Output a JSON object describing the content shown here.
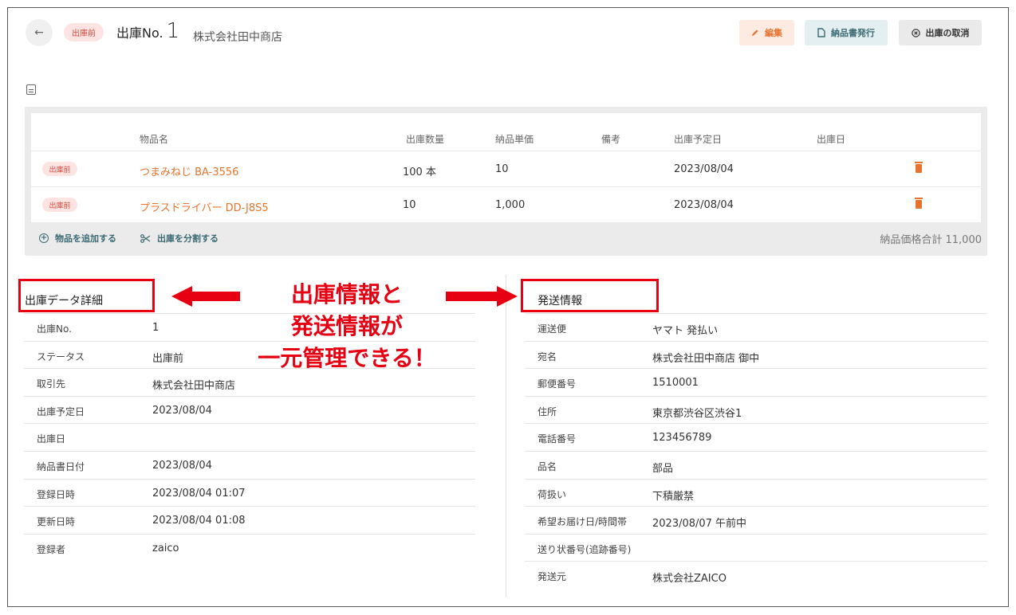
{
  "header": {
    "back_icon": "arrow-left-icon",
    "status": "出庫前",
    "title_prefix": "出庫No.",
    "title_number": "1",
    "vendor": "株式会社田中商店",
    "buttons": {
      "edit": "編集",
      "invoice": "納品書発行",
      "cancel": "出庫の取消"
    }
  },
  "items": {
    "columns": [
      "物品名",
      "出庫数量",
      "納品単価",
      "備考",
      "出庫予定日",
      "出庫日"
    ],
    "rows": [
      {
        "status": "出庫前",
        "name": "つまみねじ BA-3556",
        "qty": "100 本",
        "price": "10",
        "note": "",
        "planned": "2023/08/04",
        "date": ""
      },
      {
        "status": "出庫前",
        "name": "プラスドライバー DD-J8S5",
        "qty": "10",
        "price": "1,000",
        "note": "",
        "planned": "2023/08/04",
        "date": ""
      }
    ],
    "add_label": "物品を追加する",
    "split_label": "出庫を分割する",
    "total_label": "納品価格合計",
    "total_value": "11,000"
  },
  "detail": {
    "title": "出庫データ詳細",
    "rows": [
      {
        "key": "出庫No.",
        "value": "1"
      },
      {
        "key": "ステータス",
        "value": "出庫前"
      },
      {
        "key": "取引先",
        "value": "株式会社田中商店"
      },
      {
        "key": "出庫予定日",
        "value": "2023/08/04"
      },
      {
        "key": "出庫日",
        "value": ""
      },
      {
        "key": "納品書日付",
        "value": "2023/08/04"
      },
      {
        "key": "登録日時",
        "value": "2023/08/04 01:07"
      },
      {
        "key": "更新日時",
        "value": "2023/08/04 01:08"
      },
      {
        "key": "登録者",
        "value": "zaico"
      }
    ]
  },
  "shipping": {
    "title": "発送情報",
    "rows": [
      {
        "key": "運送便",
        "value": "ヤマト 発払い"
      },
      {
        "key": "宛名",
        "value": "株式会社田中商店 御中"
      },
      {
        "key": "郵便番号",
        "value": "1510001"
      },
      {
        "key": "住所",
        "value": "東京都渋谷区渋谷1"
      },
      {
        "key": "電話番号",
        "value": "123456789"
      },
      {
        "key": "品名",
        "value": "部品"
      },
      {
        "key": "荷扱い",
        "value": "下積厳禁"
      },
      {
        "key": "希望お届け日/時間帯",
        "value": "2023/08/07 午前中"
      },
      {
        "key": "送り状番号(追跡番号)",
        "value": ""
      },
      {
        "key": "発送元",
        "value": "株式会社ZAICO"
      }
    ]
  },
  "annotation": {
    "lines": [
      "出庫情報と",
      "発送情報が",
      "一元管理できる！"
    ],
    "color": "#e60012"
  },
  "colors": {
    "accent": "#e5742e",
    "teal": "#3c6a73",
    "status_bg": "#fde4e2",
    "status_text": "#d24b3e"
  }
}
